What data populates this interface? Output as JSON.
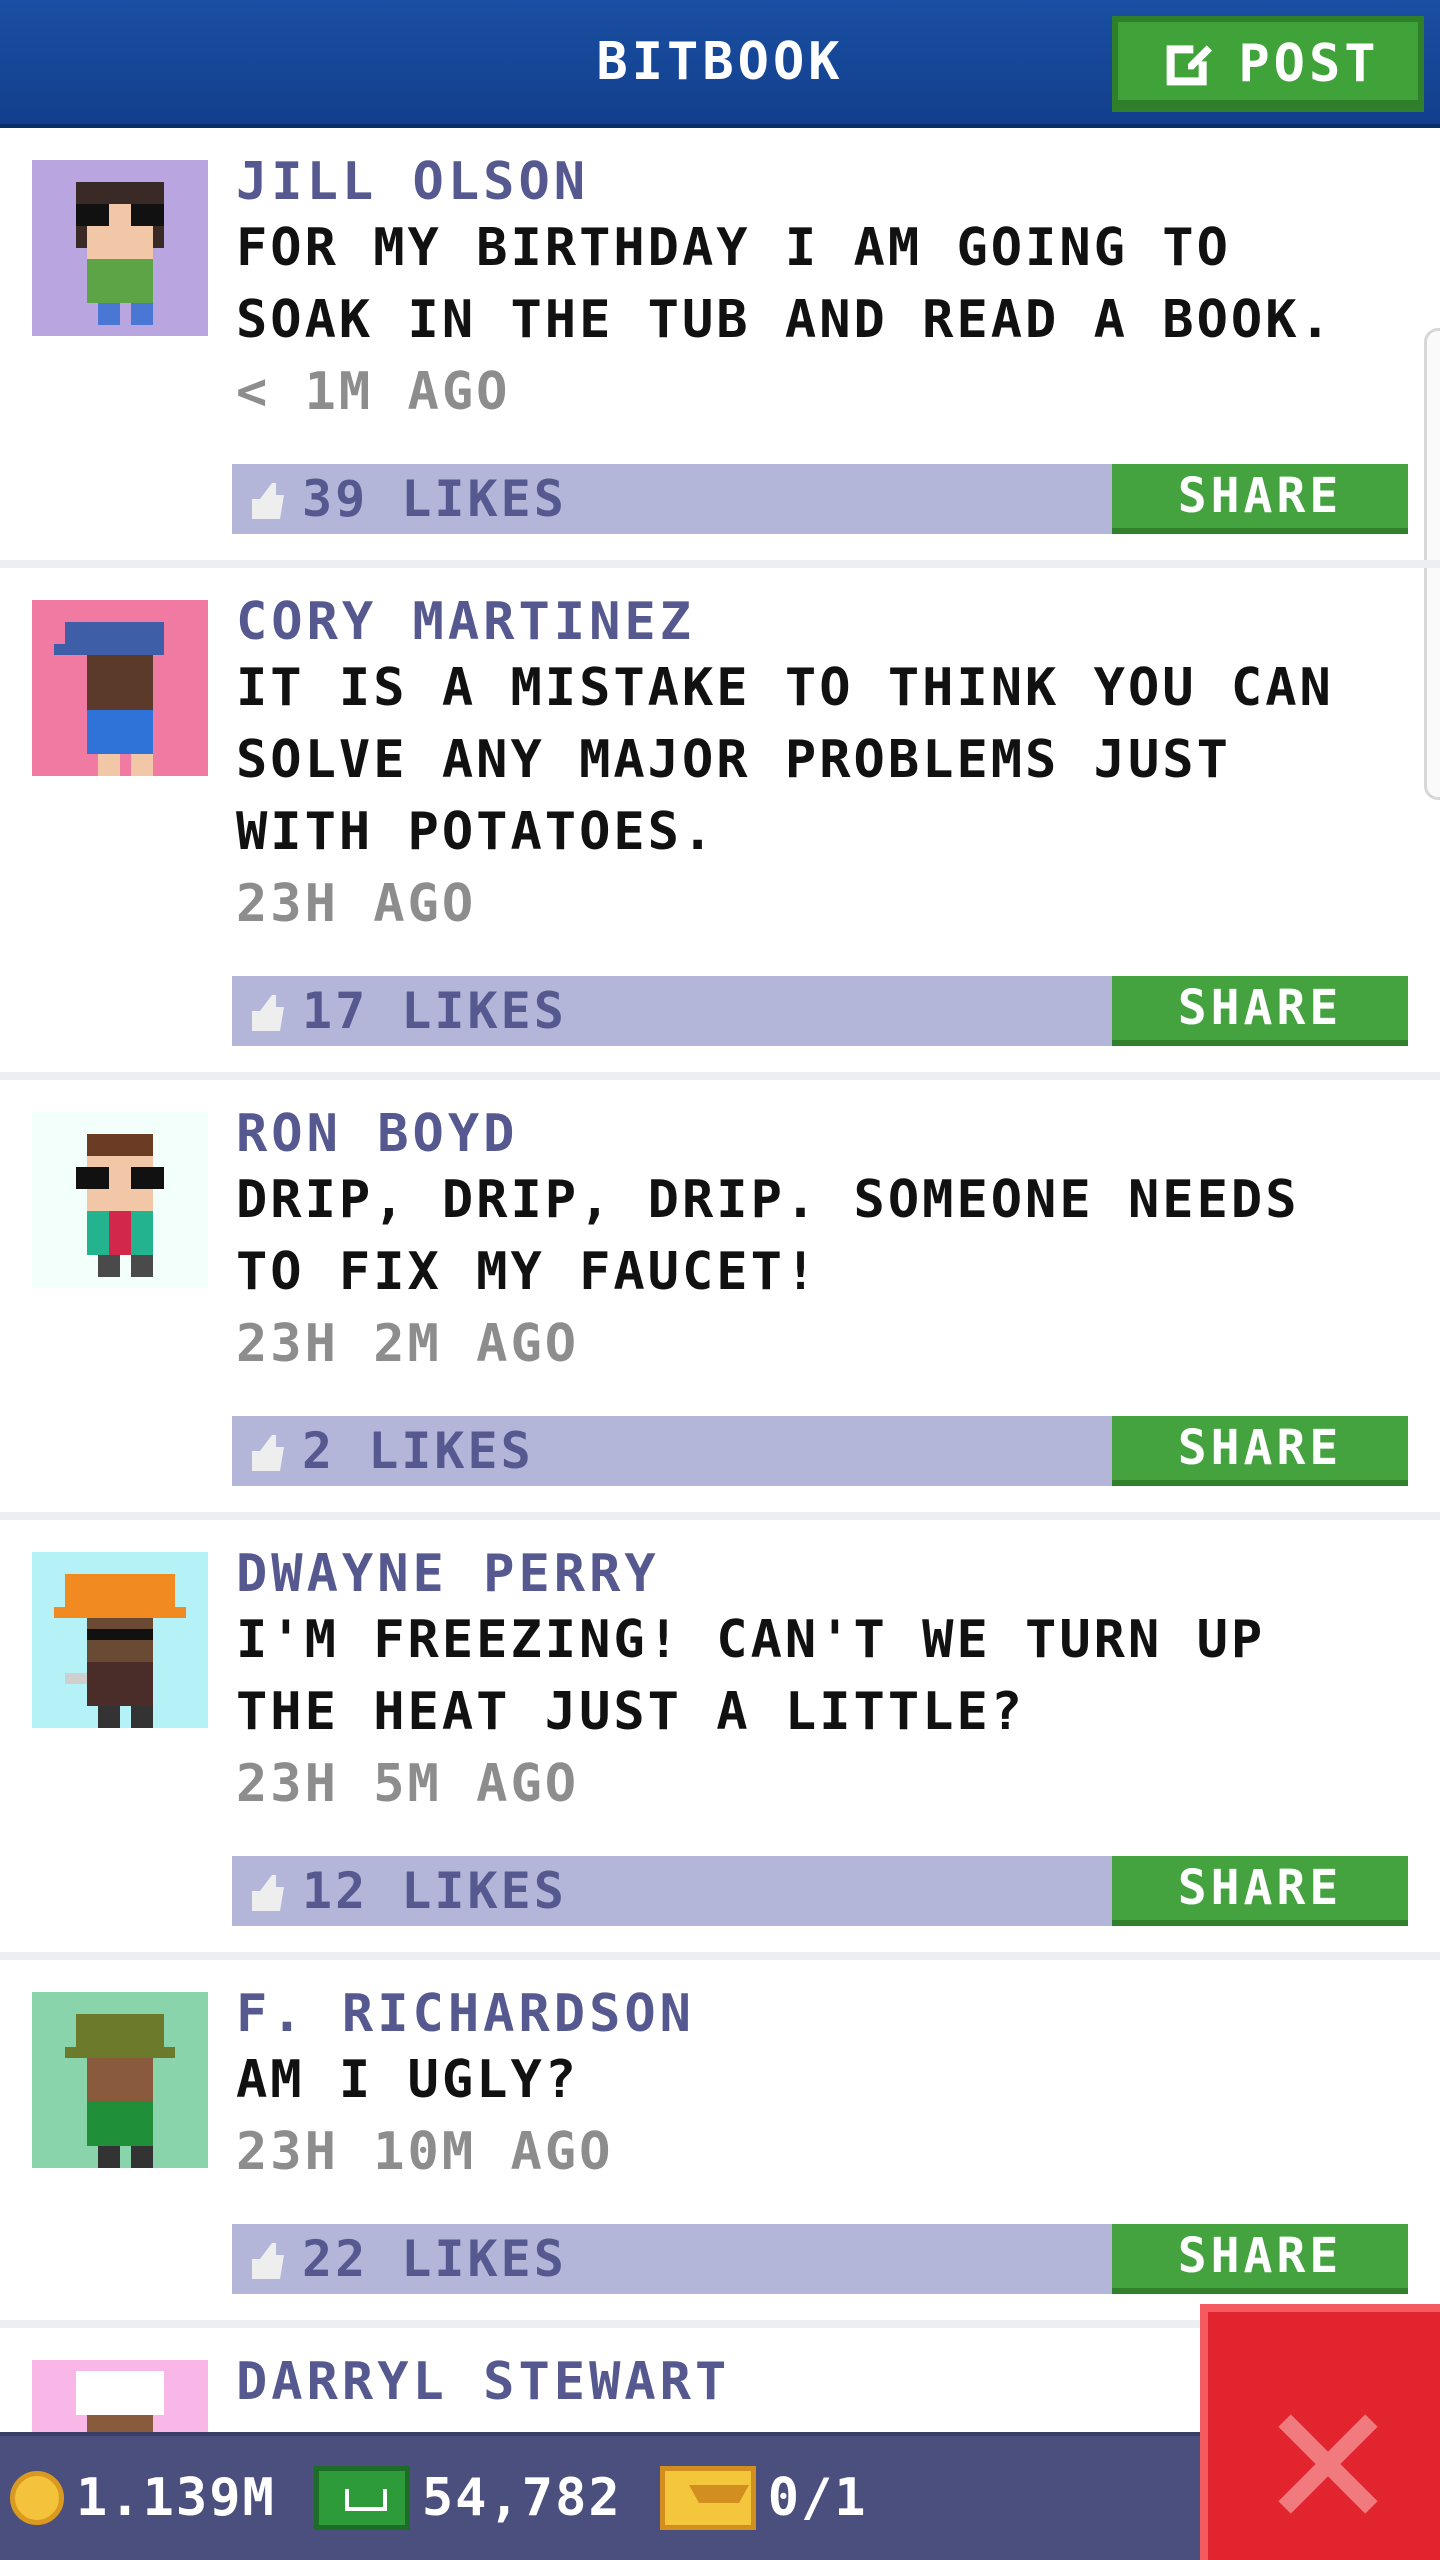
{
  "header": {
    "title": "BITBOOK",
    "post_label": "POST"
  },
  "posts": [
    {
      "author": "JILL OLSON",
      "text": "FOR MY BIRTHDAY I AM GOING TO SOAK IN THE TUB AND READ A BOOK.",
      "time": "< 1M AGO",
      "likes": "39 LIKES",
      "share": "SHARE",
      "avatar_bg": "#b9a6e0"
    },
    {
      "author": "CORY MARTINEZ",
      "text": "IT IS A MISTAKE TO THINK YOU CAN SOLVE ANY MAJOR PROBLEMS JUST WITH POTATOES.",
      "time": "23H AGO",
      "likes": "17 LIKES",
      "share": "SHARE",
      "avatar_bg": "#f07aa1"
    },
    {
      "author": "RON BOYD",
      "text": "DRIP, DRIP, DRIP. SOMEONE NEEDS TO FIX MY FAUCET!",
      "time": "23H 2M AGO",
      "likes": "2 LIKES",
      "share": "SHARE",
      "avatar_bg": "#f2fffb"
    },
    {
      "author": "DWAYNE PERRY",
      "text": "I'M FREEZING! CAN'T WE TURN UP THE HEAT JUST A LITTLE?",
      "time": "23H 5M AGO",
      "likes": "12 LIKES",
      "share": "SHARE",
      "avatar_bg": "#b5f2f7"
    },
    {
      "author": "F. RICHARDSON",
      "text": "AM I UGLY?",
      "time": "23H 10M AGO",
      "likes": "22 LIKES",
      "share": "SHARE",
      "avatar_bg": "#8ad4ab"
    },
    {
      "author": "DARRYL STEWART",
      "avatar_bg": "#f8b7e6"
    }
  ],
  "footer": {
    "coins": "1.139M",
    "bux": "54,782",
    "tickets": "0/1"
  },
  "icons": {
    "post": "edit-icon",
    "like": "thumbs-up-icon",
    "close": "close-icon",
    "coin": "coin-icon",
    "bux": "bux-icon",
    "ticket": "ticket-icon"
  },
  "colors": {
    "header": "#1a4fa3",
    "author": "#55598f",
    "likes_bar": "#b3b6d8",
    "share": "#44a33f",
    "footer": "#4b4f7e",
    "close": "#e2242f"
  }
}
